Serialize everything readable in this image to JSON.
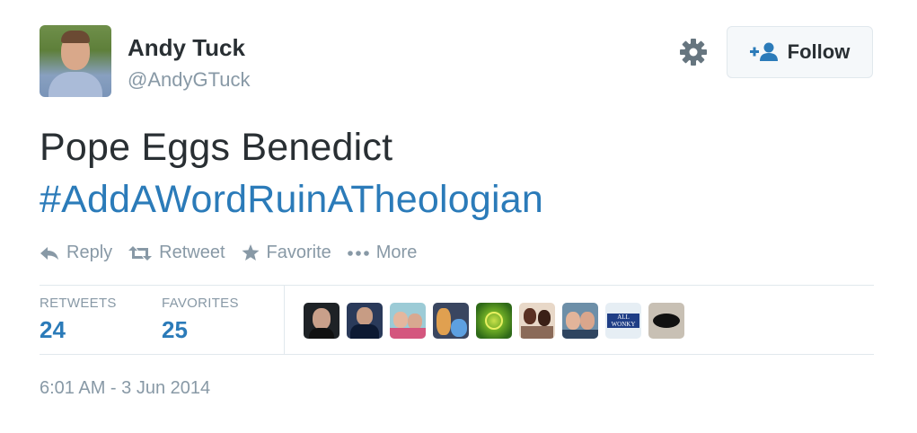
{
  "user": {
    "name": "Andy Tuck",
    "handle": "@AndyGTuck"
  },
  "follow_button": {
    "label": "Follow"
  },
  "tweet": {
    "text": "Pope Eggs Benedict",
    "hashtag": "#AddAWordRuinATheologian"
  },
  "actions": [
    {
      "label": "Reply",
      "icon": "reply-icon"
    },
    {
      "label": "Retweet",
      "icon": "retweet-icon"
    },
    {
      "label": "Favorite",
      "icon": "star-icon"
    },
    {
      "label": "More",
      "icon": "more-dots-icon"
    }
  ],
  "stats": {
    "retweets_label": "RETWEETS",
    "retweets_value": "24",
    "favorites_label": "FAVORITES",
    "favorites_value": "25"
  },
  "favoriters": {
    "avatar_8_text": "ALL WONKY"
  },
  "timestamp": "6:01 AM - 3 Jun 2014",
  "colors": {
    "link": "#2b7bb9",
    "text": "#292f33",
    "muted": "#8899a6",
    "border": "#e1e8ed"
  }
}
